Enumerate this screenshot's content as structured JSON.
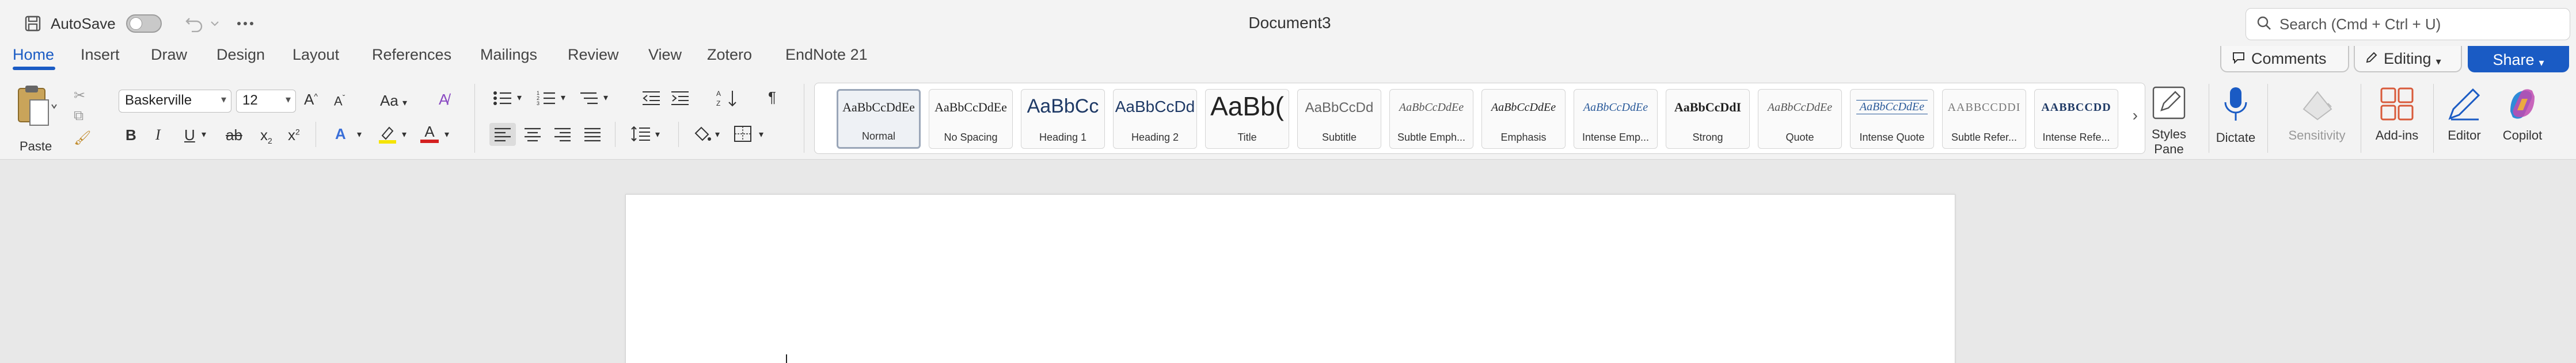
{
  "titlebar": {
    "autosave_label": "AutoSave",
    "autosave_on": false,
    "document_title": "Document3",
    "search_placeholder": "Search (Cmd + Ctrl + U)"
  },
  "tabs": [
    {
      "label": "Home",
      "active": true
    },
    {
      "label": "Insert"
    },
    {
      "label": "Draw"
    },
    {
      "label": "Design"
    },
    {
      "label": "Layout"
    },
    {
      "label": "References"
    },
    {
      "label": "Mailings"
    },
    {
      "label": "Review"
    },
    {
      "label": "View"
    },
    {
      "label": "Zotero"
    },
    {
      "label": "EndNote 21"
    }
  ],
  "actions": {
    "comments_label": "Comments",
    "editing_label": "Editing",
    "share_label": "Share"
  },
  "ribbon": {
    "paste_label": "Paste",
    "font_name": "Baskerville",
    "font_size": "12",
    "change_case": "Aa",
    "grow_font": "A",
    "shrink_font": "A",
    "bold": "B",
    "italic": "I",
    "underline": "U",
    "strike": "ab",
    "subscript": "x",
    "superscript": "x",
    "text_effects": "A",
    "font_color": "A",
    "pilcrow": "¶",
    "styles_pane_label": "Styles Pane",
    "dictate_label": "Dictate",
    "sensitivity_label": "Sensitivity",
    "addins_label": "Add-ins",
    "editor_label": "Editor",
    "copilot_label": "Copilot"
  },
  "styles": [
    {
      "preview": "AaBbCcDdEe",
      "name": "Normal",
      "selected": true
    },
    {
      "preview": "AaBbCcDdEe",
      "name": "No Spacing"
    },
    {
      "preview": "AaBbCc",
      "name": "Heading 1"
    },
    {
      "preview": "AaBbCcDd",
      "name": "Heading 2"
    },
    {
      "preview": "AaBb(",
      "name": "Title"
    },
    {
      "preview": "AaBbCcDd",
      "name": "Subtitle"
    },
    {
      "preview": "AaBbCcDdEe",
      "name": "Subtle Emph..."
    },
    {
      "preview": "AaBbCcDdEe",
      "name": "Emphasis"
    },
    {
      "preview": "AaBbCcDdEe",
      "name": "Intense Emp..."
    },
    {
      "preview": "AaBbCcDdI",
      "name": "Strong"
    },
    {
      "preview": "AaBbCcDdEe",
      "name": "Quote"
    },
    {
      "preview": "AaBbCcDdEe",
      "name": "Intense Quote"
    },
    {
      "preview": "AABBCCDDI",
      "name": "Subtle Refer..."
    },
    {
      "preview": "AABBCCDD",
      "name": "Intense Refe..."
    }
  ],
  "colors": {
    "accent": "#1a5bc4",
    "highlight": "#f5e400",
    "font_color": "#d42020"
  }
}
